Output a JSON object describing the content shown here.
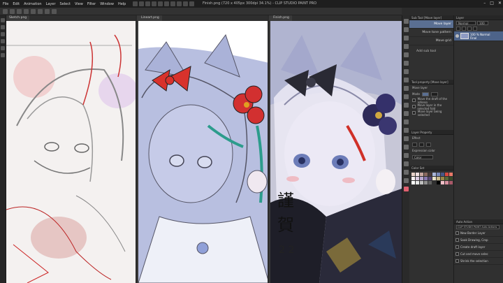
{
  "window": {
    "title": "Finish.png (720 x 405px 300dpi 34.1%) - CLIP STUDIO PAINT PRO",
    "controls": [
      "–",
      "□",
      "✕"
    ]
  },
  "menu": [
    "File",
    "Edit",
    "Animation",
    "Layer",
    "Select",
    "View",
    "Filter",
    "Window",
    "Help"
  ],
  "canvas_tabs": [
    "Sketch.png",
    "Lineart.png",
    "Finish.png"
  ],
  "sub_tool": {
    "header": "Sub Tool [Move layer]",
    "items": [
      {
        "label": "Move layer",
        "selected": true
      },
      {
        "label": "Move tone pattern",
        "selected": false
      },
      {
        "label": "Move grid",
        "selected": false
      }
    ],
    "add_label": "Add sub tool"
  },
  "tool_property": {
    "header": "Tool property [Move layer]",
    "name": "Move layer",
    "mode_label": "Mode",
    "options": [
      "Move the draft of the referen",
      "Move layer in the selected fold",
      "Move layer being selected"
    ]
  },
  "layer_property": {
    "header": "Layer Property",
    "effect_label": "Effect",
    "expression_color_label": "Expression color",
    "expression_color_value": "Color"
  },
  "color_set": {
    "header": "Color Set",
    "colors": [
      "#e8d2c8",
      "#f0e0e0",
      "#c8a8a0",
      "#8a6a60",
      "#4a3a38",
      "#a8b4d8",
      "#7888b8",
      "#485888",
      "#d84840",
      "#e87868",
      "#f8f0f0",
      "#d8c8e0",
      "#b8a8d0",
      "#8878b0",
      "#584878",
      "#e8e0c8",
      "#c8b888",
      "#988848",
      "#586838",
      "#384828",
      "#ffffff",
      "#e8e8e8",
      "#c0c0c0",
      "#909090",
      "#606060",
      "#303030",
      "#000000",
      "#f0c0c8",
      "#d890a0",
      "#a85868"
    ]
  },
  "layer_panel": {
    "header": "Layer",
    "blend_mode": "Normal",
    "opacity": "100",
    "layers": [
      {
        "label": "100 % Normal",
        "sub": "Final",
        "selected": true
      }
    ]
  },
  "auto_action": {
    "header": "Auto Action",
    "set_name": "CLIP STUDIO PAINT Auto Actions",
    "items": [
      "New Border Layer",
      "Soak Drawing, Crop",
      "Create draft layer",
      "Cut and move selec",
      "Shrink the selection"
    ]
  }
}
